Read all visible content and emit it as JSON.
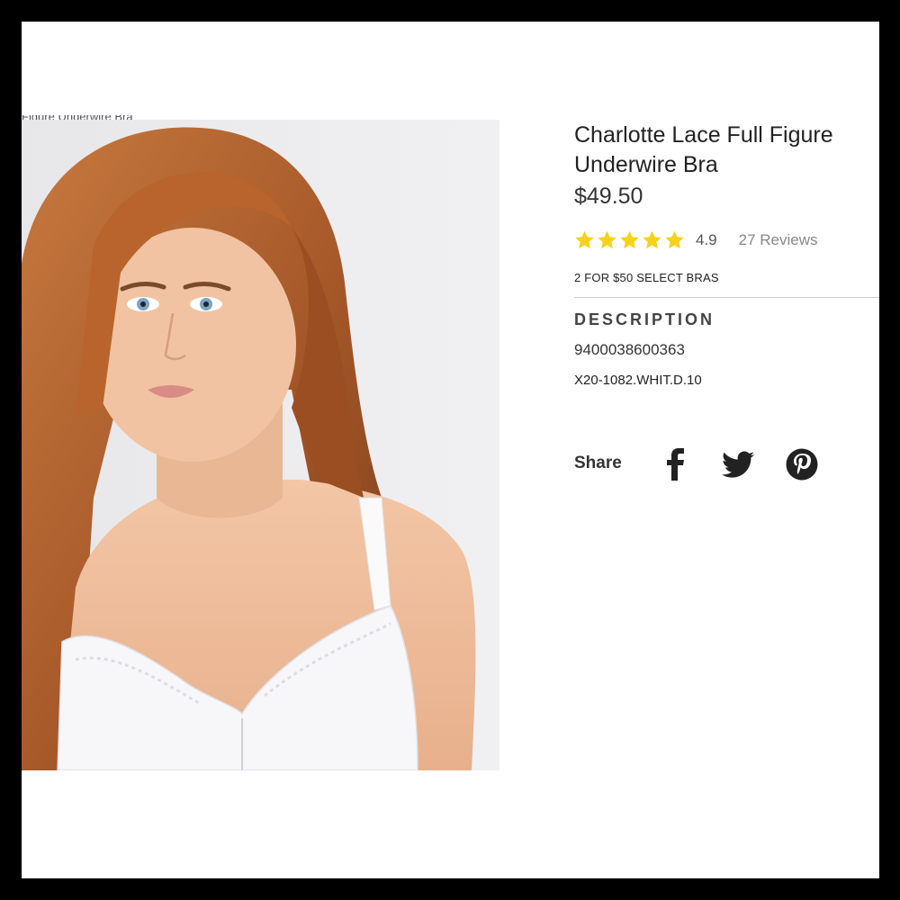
{
  "breadcrumb": "Figure Underwire Bra",
  "product": {
    "title": "Charlotte Lace Full Figure Underwire Bra",
    "price": "$49.50",
    "rating": 4.9,
    "rating_display": "4.9",
    "stars": 5,
    "star_color": "#f6d21a",
    "reviews_label": "27 Reviews",
    "promo": "2 FOR $50 SELECT BRAS"
  },
  "description": {
    "heading": "DESCRIPTION",
    "sku": "9400038600363",
    "style_code": "X20-1082.WHIT.D.10"
  },
  "share": {
    "label": "Share",
    "icons": [
      "facebook-icon",
      "twitter-icon",
      "pinterest-icon"
    ]
  }
}
